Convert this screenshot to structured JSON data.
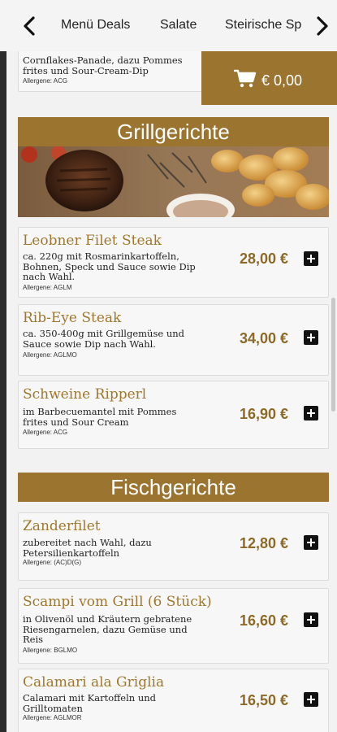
{
  "nav": {
    "tabs": [
      "Menü Deals",
      "Salate",
      "Steirische Spezialitäten"
    ],
    "prev_icon": "chevron-left-icon",
    "next_icon": "chevron-right-icon"
  },
  "cart": {
    "icon": "shopping-cart-icon",
    "total": "€ 0,00"
  },
  "partial_item": {
    "desc": "Cornflakes-Panade, dazu Pommes frites und Sour-Cream-Dip",
    "allergens": "Allergene: ACG"
  },
  "sections": [
    {
      "title": "Grillgerichte",
      "items": [
        {
          "name": "Leobner Filet Steak",
          "desc": "ca. 220g mit Rosmarinkartoffeln, Bohnen, Speck und Sauce sowie Dip nach Wahl.",
          "allergens": "Allergene: AGLM",
          "price": "28,00 €"
        },
        {
          "name": "Rib-Eye Steak",
          "desc": "ca. 350-400g mit Grillgemüse und Sauce sowie Dip nach Wahl.",
          "allergens": "Allergene: AGLMO",
          "price": "34,00 €"
        },
        {
          "name": "Schweine Ripperl",
          "desc": "im Barbecuemantel mit Pommes frites und Sour Cream",
          "allergens": "Allergene: ACG",
          "price": "16,90 €"
        }
      ]
    },
    {
      "title": "Fischgerichte",
      "items": [
        {
          "name": "Zanderfilet",
          "desc": "zubereitet nach Wahl, dazu Petersilienkartoffeln",
          "allergens": "Allergene: (AC)D(G)",
          "price": "12,80 €"
        },
        {
          "name": "Scampi vom Grill (6 Stück)",
          "desc": "in Olivenöl und Kräutern gebratene Riesengarnelen, dazu Gemüse und Reis",
          "allergens": "Allergene: BGLMO",
          "price": "16,60 €"
        },
        {
          "name": "Calamari ala Griglia",
          "desc": "Calamari mit Kartoffeln und Grilltomaten",
          "allergens": "Allergene: AGLMOR",
          "price": "16,50 €"
        }
      ]
    }
  ],
  "colors": {
    "accent": "#9b7430",
    "item_title": "#a0782d",
    "price": "#8d6a28"
  }
}
